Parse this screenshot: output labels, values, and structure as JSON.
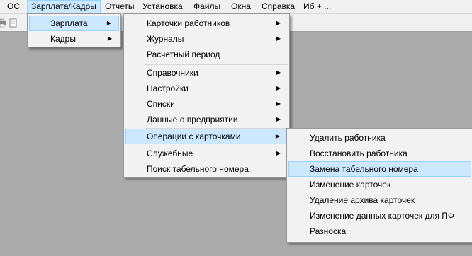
{
  "menubar": {
    "items": [
      "ОС",
      "Зарплата/Кадры",
      "Отчеты",
      "Установка",
      "Файлы",
      "Окна",
      "Справка",
      "Иб + ..."
    ]
  },
  "menu1": {
    "items": [
      "Зарплата",
      "Кадры"
    ]
  },
  "menu2": {
    "items": [
      "Карточки работников",
      "Журналы",
      "Расчетный период",
      "Справочники",
      "Настройки",
      "Списки",
      "Данные о предприятии",
      "Операции с карточками",
      "Служебные",
      "Поиск табельного номера"
    ]
  },
  "menu3": {
    "items": [
      "Удалить работника",
      "Восстановить работника",
      "Замена табельного номера",
      "Изменение карточек",
      "Удаление архива карточек",
      "Изменение данных карточек для ПФ",
      "Разноска"
    ]
  },
  "icons": {
    "submenu_arrow": "submenu-arrow-icon"
  }
}
